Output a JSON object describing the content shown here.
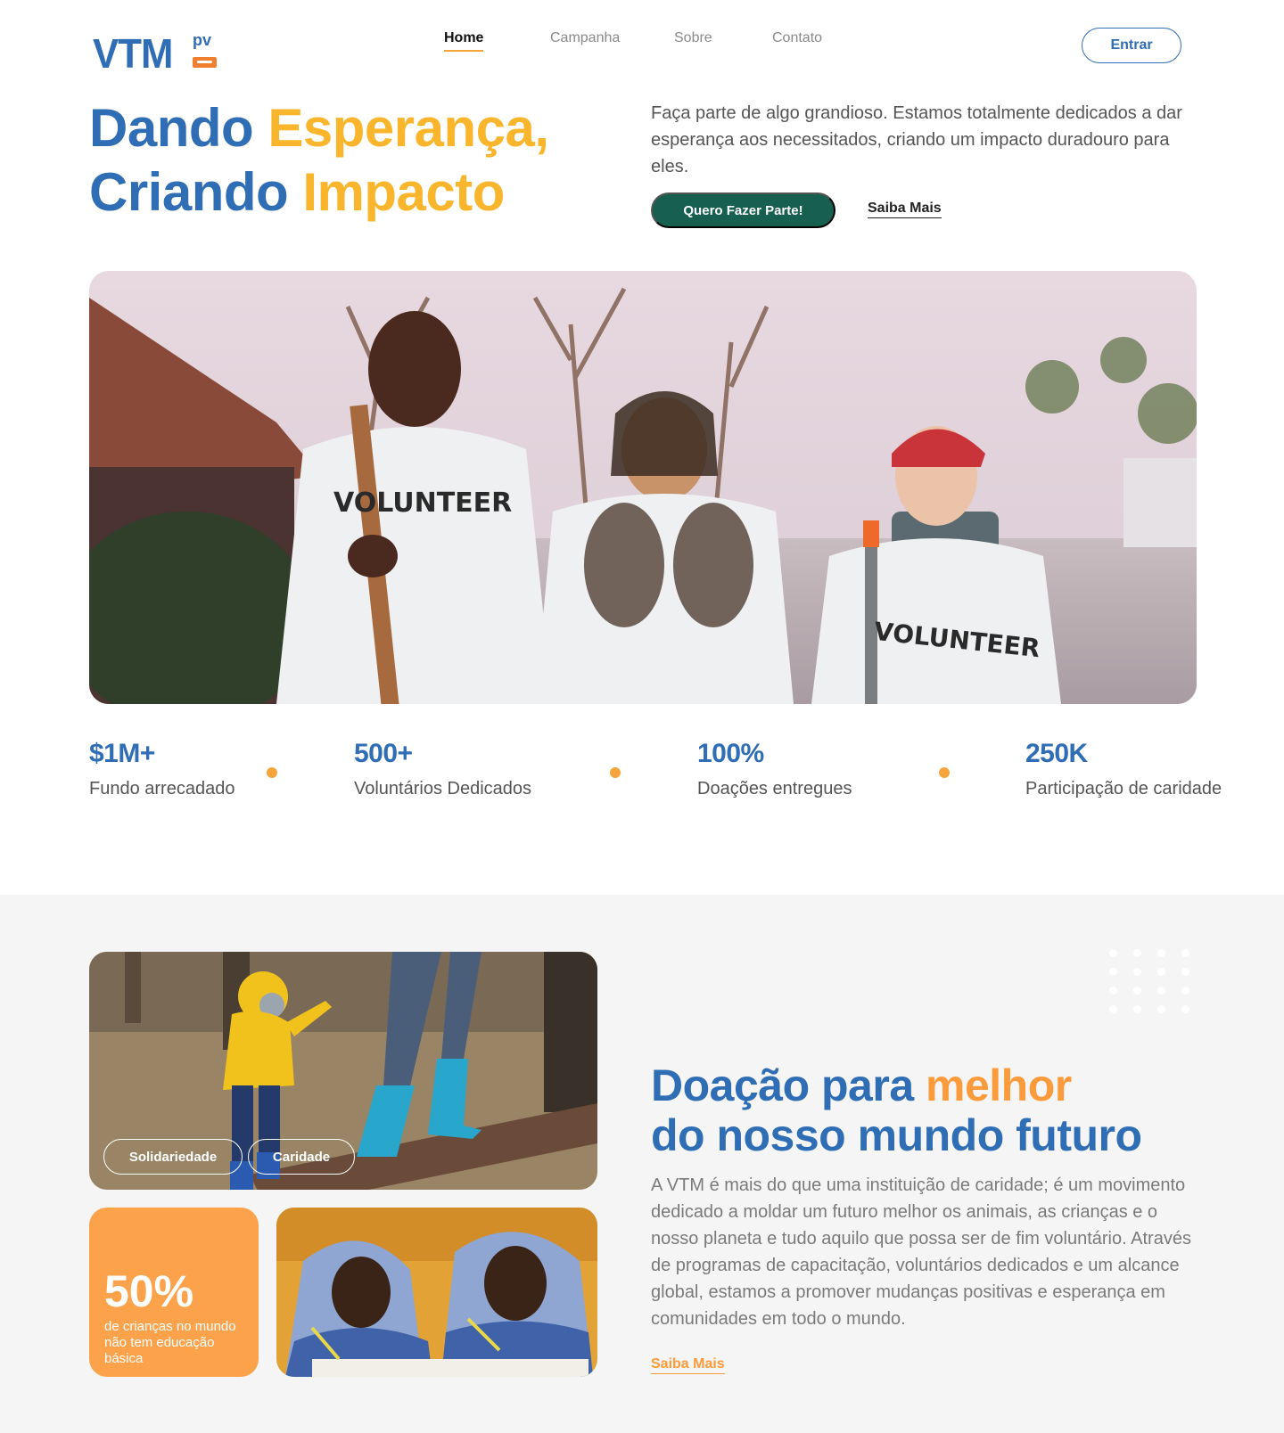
{
  "brand": {
    "logo_main": "VTM",
    "logo_sub": "pv",
    "colors": {
      "primary_blue": "#2f6db5",
      "accent_yellow": "#f9b52c",
      "accent_orange": "#fb9b3b",
      "green": "#17604f"
    }
  },
  "nav": {
    "items": [
      {
        "label": "Home",
        "active": true
      },
      {
        "label": "Campanha",
        "active": false
      },
      {
        "label": "Sobre",
        "active": false
      },
      {
        "label": "Contato",
        "active": false
      }
    ],
    "login_label": "Entrar"
  },
  "hero": {
    "title_part1": "Dando ",
    "title_accent1": "Esperança,",
    "title_part2": "Criando ",
    "title_accent2": "Impacto",
    "description": "Faça parte de algo grandioso. Estamos totalmente dedicados a dar esperança aos necessitados, criando um impacto duradouro para eles.",
    "cta_primary": "Quero Fazer Parte!",
    "cta_secondary": "Saiba Mais",
    "image_text": "VOLUNTEER"
  },
  "stats": [
    {
      "value": "$1M+",
      "label": "Fundo arrecadado"
    },
    {
      "value": "500+",
      "label": "Voluntários Dedicados"
    },
    {
      "value": "100%",
      "label": "Doações entregues"
    },
    {
      "value": "250K",
      "label": "Participação de caridade"
    }
  ],
  "donation": {
    "chips": [
      "Solidariedade",
      "Caridade"
    ],
    "stat_value": "50%",
    "stat_label": "de crianças no mundo não tem educação básica",
    "title_part1": "Doação para ",
    "title_accent": "melhor",
    "title_part2": "do nosso mundo futuro",
    "description": "A VTM é mais do que uma instituição de caridade; é um movimento dedicado a moldar um futuro melhor os animais, as crianças e o nosso planeta e tudo aquilo que possa ser de fim voluntário. Através de programas de capacitação, voluntários dedicados e um alcance global, estamos a promover mudanças positivas e esperança em comunidades em todo o mundo.",
    "link_label": "Saiba Mais"
  }
}
